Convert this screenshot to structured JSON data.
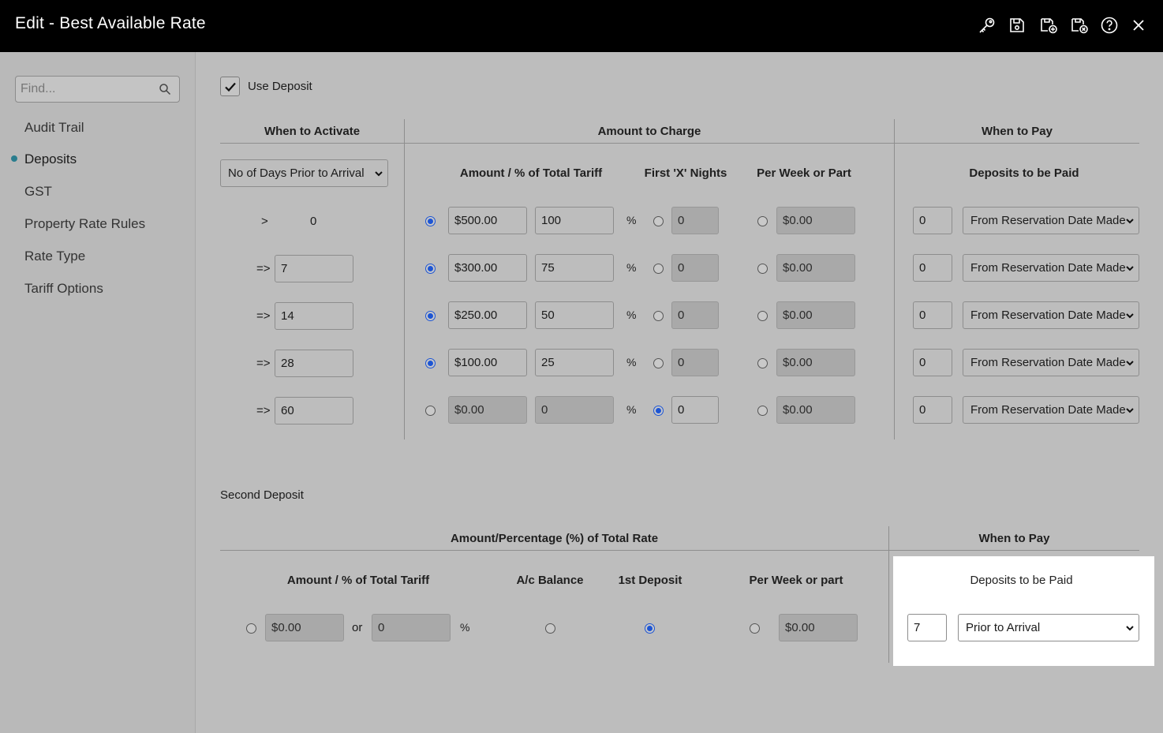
{
  "window": {
    "title": "Edit - Best Available Rate"
  },
  "toolbar": {
    "icons": [
      "key-icon",
      "save-icon",
      "save-and-new-icon",
      "save-and-close-icon",
      "help-icon",
      "close-icon"
    ]
  },
  "sidebar": {
    "search_placeholder": "Find...",
    "items": [
      {
        "label": "Audit Trail"
      },
      {
        "label": "Deposits",
        "active": true
      },
      {
        "label": "GST"
      },
      {
        "label": "Property Rate Rules"
      },
      {
        "label": "Rate Type"
      },
      {
        "label": "Tariff Options"
      }
    ]
  },
  "use_deposit": {
    "label": "Use Deposit",
    "checked": true
  },
  "deposit_table": {
    "group_headers": {
      "when_to_activate": "When to Activate",
      "amount_to_charge": "Amount to Charge",
      "when_to_pay": "When to Pay"
    },
    "activate_select": "No of Days Prior to Arrival",
    "sub_headers": {
      "amount_pct": "Amount / % of Total Tariff",
      "first_x_nights": "First 'X' Nights",
      "per_week": "Per Week or Part",
      "deposits_to_be_paid": "Deposits to be Paid"
    },
    "percent_symbol": "%",
    "rows": [
      {
        "op": ">",
        "days": "0",
        "amount": "$500.00",
        "percent": "100",
        "nights": "0",
        "per_week": "$0.00",
        "pay_days": "0",
        "pay_from": "From Reservation Date Made",
        "selected": "amount"
      },
      {
        "op": "=>",
        "days": "7",
        "amount": "$300.00",
        "percent": "75",
        "nights": "0",
        "per_week": "$0.00",
        "pay_days": "0",
        "pay_from": "From Reservation Date Made",
        "selected": "amount"
      },
      {
        "op": "=>",
        "days": "14",
        "amount": "$250.00",
        "percent": "50",
        "nights": "0",
        "per_week": "$0.00",
        "pay_days": "0",
        "pay_from": "From Reservation Date Made",
        "selected": "amount"
      },
      {
        "op": "=>",
        "days": "28",
        "amount": "$100.00",
        "percent": "25",
        "nights": "0",
        "per_week": "$0.00",
        "pay_days": "0",
        "pay_from": "From Reservation Date Made",
        "selected": "amount"
      },
      {
        "op": "=>",
        "days": "60",
        "amount": "$0.00",
        "percent": "0",
        "nights": "0",
        "per_week": "$0.00",
        "pay_days": "0",
        "pay_from": "From Reservation Date Made",
        "selected": "nights"
      }
    ]
  },
  "second_deposit": {
    "title": "Second Deposit",
    "group_headers": {
      "amount_pct_total_rate": "Amount/Percentage (%) of Total Rate",
      "when_to_pay": "When to Pay"
    },
    "sub_headers": {
      "amount_pct": "Amount / % of Total Tariff",
      "ac_balance": "A/c Balance",
      "first_deposit": "1st Deposit",
      "per_week": "Per Week or part",
      "deposits_to_be_paid": "Deposits to be Paid"
    },
    "amount": "$0.00",
    "or_label": "or",
    "percent": "0",
    "percent_symbol": "%",
    "per_week": "$0.00",
    "selected": "first_deposit",
    "pay_days": "7",
    "pay_when": "Prior to Arrival"
  }
}
